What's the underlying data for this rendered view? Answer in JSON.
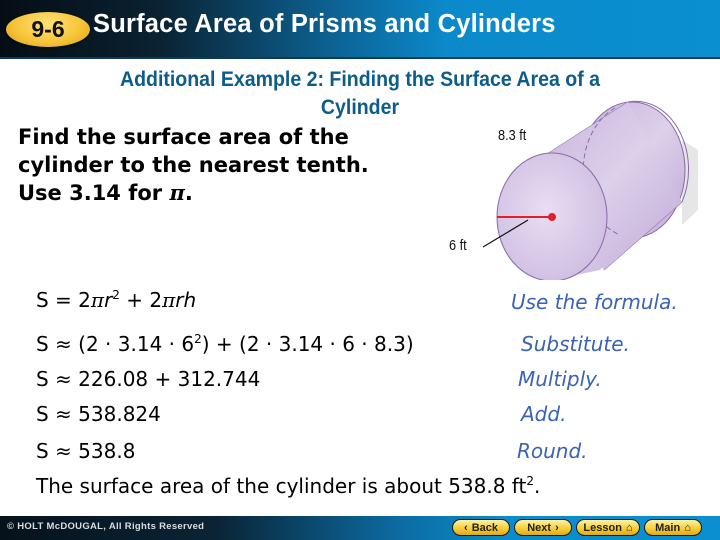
{
  "header": {
    "lesson_number": "9-6",
    "title": "Surface Area of Prisms and Cylinders"
  },
  "example": {
    "title_line1": "Additional Example 2: Finding the Surface Area of a",
    "title_line2": "Cylinder",
    "prompt_line1": "Find the surface area of the",
    "prompt_line2": "cylinder to the nearest tenth.",
    "prompt_line3_prefix": "Use 3.14 for ",
    "prompt_line3_pi": "π",
    "prompt_line3_suffix": "."
  },
  "figure": {
    "shape": "cylinder",
    "height_label": "8.3 ft",
    "radius_label": "6 ft",
    "radius_color": "#e0202a",
    "fill_color": "#d7c8e6"
  },
  "solution": {
    "steps": [
      {
        "parts": {
          "a": "S = 2",
          "pi1": "π",
          "r": "r",
          "exp": "2",
          "b": " + 2",
          "pi2": "π",
          "rh": "rh"
        },
        "note": "Use the formula."
      },
      {
        "expr_a": "S ≈ (2 · 3.14 · 6",
        "expr_exp": "2",
        "expr_b": ") + (2 · 3.14 · 6 · 8.3)",
        "note": "Substitute."
      },
      {
        "expr": "S ≈ 226.08 + 312.744",
        "note": "Multiply."
      },
      {
        "expr": "S ≈ 538.824",
        "note": "Add."
      },
      {
        "expr": "S ≈ 538.8",
        "note": "Round."
      }
    ],
    "conclusion_text": "The surface area of the cylinder is about 538.8 ft",
    "conclusion_exp": "2",
    "conclusion_end": "."
  },
  "footer": {
    "copyright": "© HOLT McDOUGAL, All Rights Reserved",
    "buttons": [
      {
        "label": "Back",
        "icon": "chevron-left"
      },
      {
        "label": "Next",
        "icon": "chevron-right"
      },
      {
        "label": "Lesson",
        "icon": "home"
      },
      {
        "label": "Main",
        "icon": "home"
      }
    ]
  }
}
